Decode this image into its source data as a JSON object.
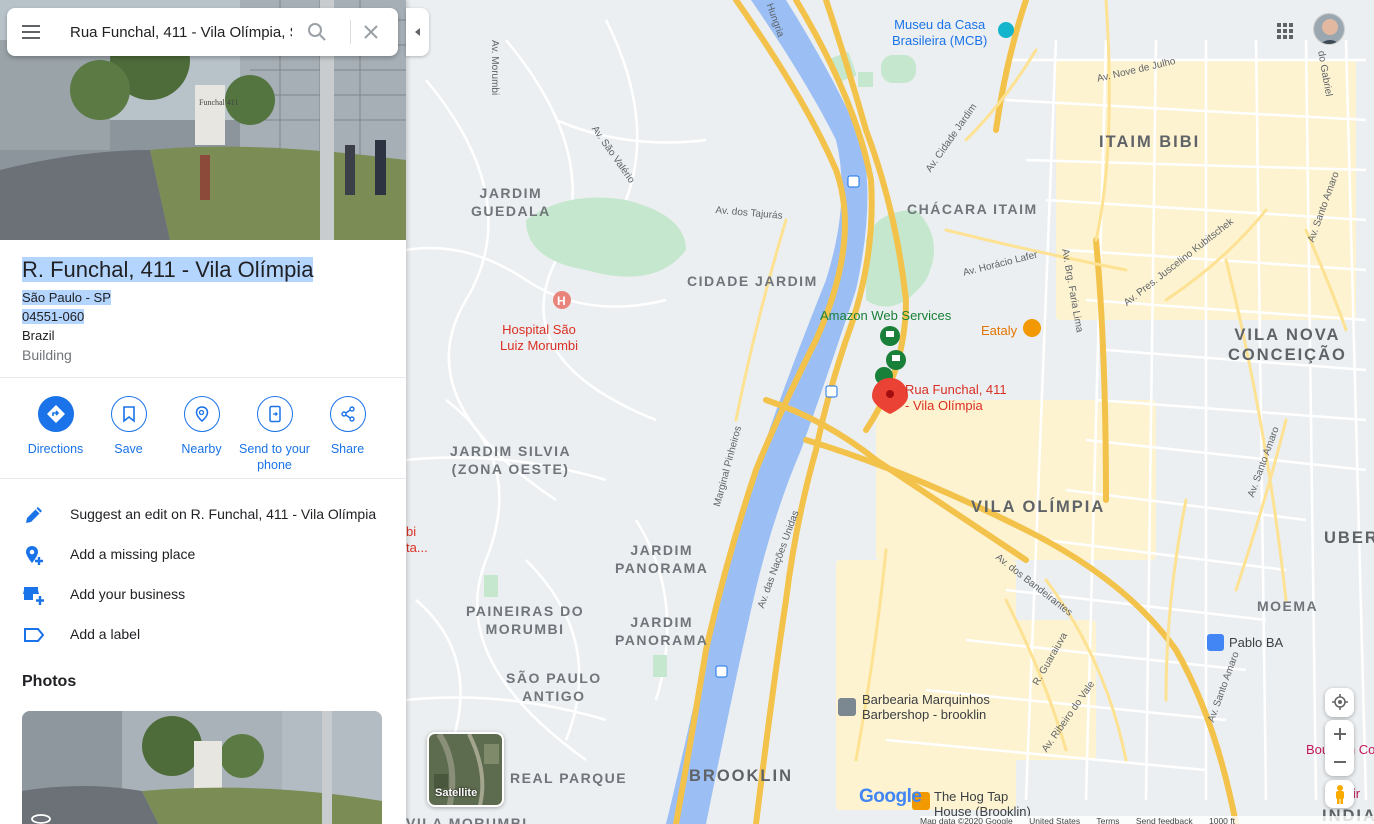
{
  "search": {
    "value": "Rua Funchal, 411 - Vila Olímpia, S"
  },
  "place": {
    "title": "R. Funchal, 411 - Vila Olímpia",
    "address_lines": [
      "São Paulo - SP",
      "04551-060",
      "Brazil"
    ],
    "type": "Building"
  },
  "hero_image": {
    "sign_text": "Funchal 411"
  },
  "actions": [
    {
      "label": "Directions",
      "icon": "directions-icon"
    },
    {
      "label": "Save",
      "icon": "bookmark-icon"
    },
    {
      "label": "Nearby",
      "icon": "nearby-icon"
    },
    {
      "label": "Send to your phone",
      "icon": "send-to-phone-icon"
    },
    {
      "label": "Share",
      "icon": "share-icon"
    }
  ],
  "options": [
    {
      "label": "Suggest an edit on R. Funchal, 411 - Vila Olímpia",
      "icon": "pencil-icon"
    },
    {
      "label": "Add a missing place",
      "icon": "add-place-icon"
    },
    {
      "label": "Add your business",
      "icon": "add-business-icon"
    },
    {
      "label": "Add a label",
      "icon": "label-icon"
    }
  ],
  "photos": {
    "heading": "Photos"
  },
  "map": {
    "areas": [
      {
        "text": "JARDIM\nGUEDALA"
      },
      {
        "text": "CIDADE JARDIM"
      },
      {
        "text": "CHÁCARA ITAIM"
      },
      {
        "text": "ITAIM BIBI"
      },
      {
        "text": "VILA NOVA\nCONCEIÇÃO"
      },
      {
        "text": "JARDIM SILVIA\n(ZONA OESTE)"
      },
      {
        "text": "JARDIM\nPANORAMA"
      },
      {
        "text": "JARDIM\nPANORAMA"
      },
      {
        "text": "PAINEIRAS DO\nMORUMBI"
      },
      {
        "text": "SÃO PAULO\nANTIGO"
      },
      {
        "text": "REAL PARQUE"
      },
      {
        "text": "VILA MORUMBI"
      },
      {
        "text": "VILA OLÍMPIA"
      },
      {
        "text": "BROOKLIN"
      },
      {
        "text": "MOEMA"
      },
      {
        "text": "UBER"
      },
      {
        "text": "INDIAN"
      }
    ],
    "streets": [
      "Av. Morumbi",
      "Hungria",
      "Av. Nove de Julho",
      "Av. São Valério",
      "Av. dos Tajurás",
      "Av. Cidade Jardim",
      "Av. Horácio Lafer",
      "Av. Brg. Faria Lima",
      "Av. Pres. Juscelino Kubitschek",
      "Av. Santo Amaro",
      "Marginal Pinheiros",
      "Av. das Nações Unidas",
      "Av. dos Bandeirantes",
      "R. Guaraiuva",
      "Av. Ribeiro do Vale",
      "Av. Santo Amaro",
      "Av. Santo Amaro",
      "do Gabriel"
    ],
    "pois": {
      "museum": "Museu da Casa\nBrasileira (MCB)",
      "hospital": "Hospital São\nLuiz Morumbi",
      "aws": "Amazon Web Services",
      "eataly": "Eataly",
      "pin": "Rua Funchal, 411\n- Vila Olímpia",
      "pablo": "Pablo BA",
      "barber": "Barbearia Marquinhos\nBarbershop - brooklin",
      "hogtap": "The Hog Tap\nHouse (Brooklin)",
      "bourbon": "Bourbon Conv",
      "bourbon2": "Ibir",
      "left_cut": "bi\nta..."
    },
    "satellite_label": "Satellite",
    "logo": "Google",
    "footer": [
      "Map data ©2020 Google",
      "United States",
      "Terms",
      "Send feedback",
      "1000 ft"
    ]
  },
  "colors": {
    "accent": "#1a73e8",
    "highway": "#fbc02d",
    "river": "#8ab4f8",
    "park": "#a8dab5",
    "pin": "#ea4335"
  }
}
